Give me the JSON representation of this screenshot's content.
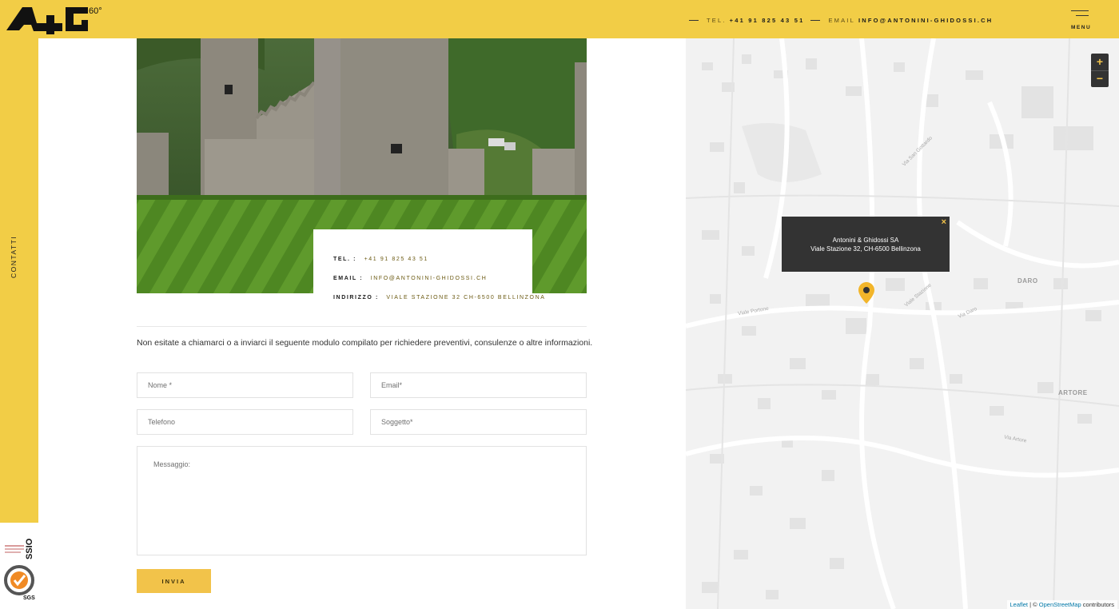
{
  "header": {
    "logo_text": "A+G",
    "logo_sup": "60°",
    "tel_label": "TEL.",
    "tel_value": "+41 91 825 43 51",
    "email_label": "EMAIL",
    "email_value": "INFO@ANTONINI-GHIDOSSI.CH",
    "menu_label": "MENU"
  },
  "sidebar": {
    "vertical_label": "CONTATTI"
  },
  "badges": {
    "ssio": "SSIO",
    "sgs": "SGS"
  },
  "info_card": {
    "tel_label": "TEL. :",
    "tel_value": "+41 91 825 43 51",
    "email_label": "EMAIL :",
    "email_value": "INFO@ANTONINI-GHIDOSSI.CH",
    "address_label": "INDIRIZZO :",
    "address_value": "VIALE STAZIONE 32 CH-6500 BELLINZONA"
  },
  "intro_text": "Non esitate a chiamarci o a inviarci il seguente modulo compilato per richiedere preventivi, consulenze o altre informazioni.",
  "form": {
    "name_placeholder": "Nome *",
    "email_placeholder": "Email*",
    "phone_placeholder": "Telefono",
    "subject_placeholder": "Soggetto*",
    "message_placeholder": "Messaggio:",
    "submit_label": "INVIA"
  },
  "map": {
    "zoom_in": "+",
    "zoom_out": "−",
    "popup_line1": "Antonini & Ghidossi SA",
    "popup_line2": "Viale Stazione 32, CH-6500 Bellinzona",
    "popup_close": "×",
    "area_labels": [
      "DARO",
      "ARTORE"
    ],
    "streets": [
      "Via San Gottardo",
      "Viale Portone",
      "Via Artore",
      "Via Daro",
      "Viale Stazione"
    ],
    "attribution_leaflet": "Leaflet",
    "attribution_sep": " | © ",
    "attribution_osm": "OpenStreetMap",
    "attribution_tail": " contributors"
  },
  "colors": {
    "brand_yellow": "#f2cd46",
    "button_yellow": "#f2c34a",
    "dark": "#333333"
  }
}
